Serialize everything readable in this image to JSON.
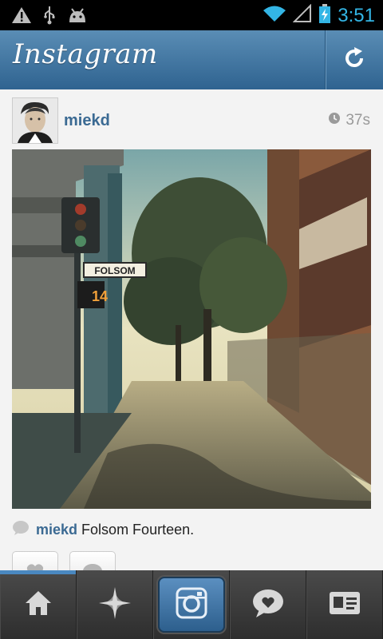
{
  "status_bar": {
    "time": "3:51",
    "icons": [
      "warning-icon",
      "usb-icon",
      "android-icon",
      "wifi-icon",
      "signal-icon",
      "battery-icon"
    ]
  },
  "header": {
    "title": "Instagram",
    "refresh_icon": "refresh-icon"
  },
  "post": {
    "username": "miekd",
    "timestamp": "37s",
    "street_sign": "FOLSOM",
    "caption": {
      "user": "miekd",
      "text": "Folsom Fourteen."
    }
  },
  "tabs": [
    {
      "name": "home",
      "icon": "home-icon"
    },
    {
      "name": "explore",
      "icon": "star-icon"
    },
    {
      "name": "camera",
      "icon": "camera-icon"
    },
    {
      "name": "news",
      "icon": "speech-heart-icon"
    },
    {
      "name": "profile",
      "icon": "profile-card-icon"
    }
  ],
  "colors": {
    "accent": "#3b6a93",
    "header_blue": "#2f6390",
    "status_time": "#33b5e5"
  }
}
